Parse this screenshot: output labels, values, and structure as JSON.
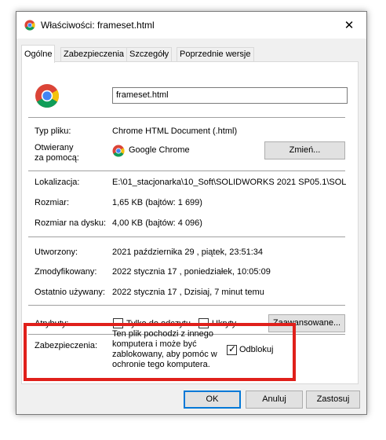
{
  "window": {
    "title": "Właściwości: frameset.html",
    "close_glyph": "✕"
  },
  "tabs": [
    {
      "label": "Ogólne",
      "active": true
    },
    {
      "label": "Zabezpieczenia",
      "active": false
    },
    {
      "label": "Szczegóły",
      "active": false
    },
    {
      "label": "Poprzednie wersje",
      "active": false
    }
  ],
  "file": {
    "name": "frameset.html"
  },
  "rows": {
    "type_label": "Typ pliku:",
    "type_value": "Chrome HTML Document (.html)",
    "opens_label_1": "Otwierany",
    "opens_label_2": "za pomocą:",
    "opens_value": "Google Chrome",
    "change_button": "Zmień...",
    "location_label": "Lokalizacja:",
    "location_value": "E:\\01_stacjonarka\\10_Soft\\SOLIDWORKS 2021 SP05.1\\SOL",
    "size_label": "Rozmiar:",
    "size_value": "1,65 KB (bajtów: 1 699)",
    "disk_label": "Rozmiar na dysku:",
    "disk_value": "4,00 KB (bajtów: 4 096)",
    "created_label": "Utworzony:",
    "created_value": "2021 października 29 , piątek, 23:51:34",
    "modified_label": "Zmodyfikowany:",
    "modified_value": "2022 stycznia 17 , poniedziałek, 10:05:09",
    "accessed_label": "Ostatnio używany:",
    "accessed_value": "2022 stycznia 17 , Dzisiaj, 7 minut temu",
    "attr_label": "Atrybuty:",
    "readonly_label": "Tylko do odczytu",
    "hidden_label": "Ukryty",
    "advanced_button": "Zaawansowane...",
    "security_label": "Zabezpieczenia:",
    "security_text": "Ten plik pochodzi z innego komputera i może być zablokowany, aby pomóc w ochronie tego komputera.",
    "unblock_label": "Odblokuj"
  },
  "checkboxes": {
    "readonly": false,
    "hidden": false,
    "unblock": true
  },
  "footer": {
    "ok": "OK",
    "cancel": "Anuluj",
    "apply": "Zastosuj"
  },
  "colors": {
    "highlight_border": "#e0201b",
    "default_button_border": "#0078d7"
  },
  "icons": {
    "app": "chrome-icon",
    "close": "close-icon",
    "check": "checkmark-icon"
  }
}
